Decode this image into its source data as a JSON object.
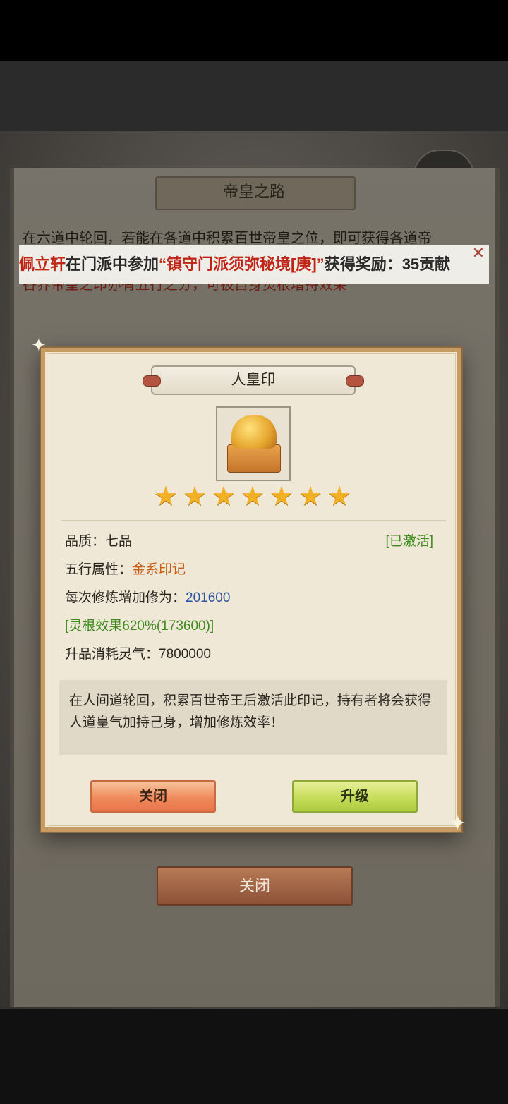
{
  "background_panel": {
    "title": "帝皇之路",
    "description": "在六道中轮回，若能在各道中积累百世帝皇之位，即可获得各道帝",
    "note": "各界帝皇之印亦有五行之分，可被自身灵根增持效果",
    "close_button": "关闭"
  },
  "marquee": {
    "player": "佩立轩",
    "text_1": "在门派中参加",
    "event": "“镇守门派须弥秘境[庚]”",
    "text_2": "获得奖励：35贡献",
    "close_glyph": "✕"
  },
  "dialog": {
    "title": "人皇印",
    "star_glyph": "★",
    "stars": 7,
    "quality_label": "品质：",
    "quality_value": "七品",
    "status": "[已激活]",
    "element_label": "五行属性：",
    "element_value": "金系印记",
    "cultivation_label": "每次修炼增加修为：",
    "cultivation_value": "201600",
    "spirit_root_effect": "[灵根效果620%(173600)]",
    "upgrade_cost_label": "升品消耗灵气：",
    "upgrade_cost_value": "7800000",
    "description": "在人间道轮回，积累百世帝王后激活此印记，持有者将会获得人道皇气加持己身，增加修炼效率！",
    "close_button": "关闭",
    "upgrade_button": "升级"
  },
  "colors": {
    "dialog_bg": "#efe8d7",
    "dialog_border": "#c69b64",
    "orange_text": "#c65d13",
    "blue_text": "#2a55a4",
    "green_text": "#3f8b1f",
    "star": "#f2b125"
  },
  "icons": {
    "item": "imperial-seal-icon",
    "star": "star-icon",
    "close": "close-icon"
  }
}
